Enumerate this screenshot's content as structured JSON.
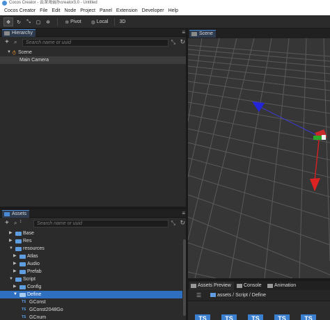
{
  "window": {
    "title": "Cocos Creator - 云深海弱乐creator3.0 - Untitled"
  },
  "menubar": [
    "Cocos Creator",
    "File",
    "Edit",
    "Node",
    "Project",
    "Panel",
    "Extension",
    "Developer",
    "Help"
  ],
  "toolbar": {
    "pivot": "Pivot",
    "local": "Local",
    "mode_3d": "3D"
  },
  "hierarchy": {
    "title": "Hierarchy",
    "search_placeholder": "Search name or uuid",
    "nodes": [
      {
        "label": "Scene"
      },
      {
        "label": "Main Camera"
      }
    ]
  },
  "scene": {
    "title": "Scene"
  },
  "assets": {
    "title": "Assets",
    "search_placeholder": "Search name or uuid",
    "items": [
      {
        "label": "Base"
      },
      {
        "label": "Res"
      },
      {
        "label": "resources"
      },
      {
        "label": "Atlas"
      },
      {
        "label": "Audio"
      },
      {
        "label": "Prefab"
      },
      {
        "label": "Script"
      },
      {
        "label": "Config"
      },
      {
        "label": "Define"
      },
      {
        "label": "GConst",
        "badge": "TS"
      },
      {
        "label": "GConst2048Go",
        "badge": "TS"
      },
      {
        "label": "GCnum",
        "badge": "TS"
      }
    ]
  },
  "bottom_tabs": [
    "Assets Preview",
    "Console",
    "Animation"
  ],
  "breadcrumb": {
    "path": "assets / Script / Define"
  },
  "preview_badges": [
    "TS",
    "TS",
    "TS",
    "TS",
    "TS"
  ]
}
